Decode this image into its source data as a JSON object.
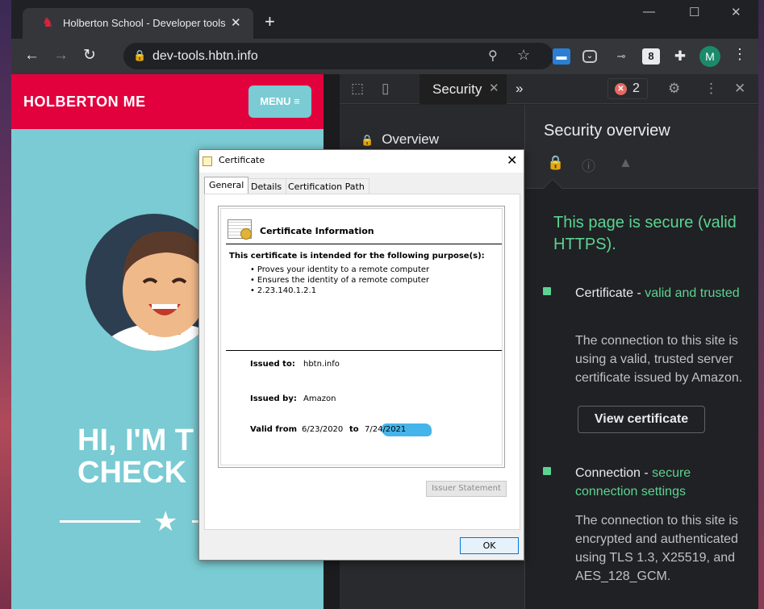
{
  "browser": {
    "tab_title": "Holberton School - Developer tools",
    "tab_close": "✕",
    "new_tab": "+",
    "window_controls": {
      "minimize": "—",
      "maximize": "☐",
      "close": "✕"
    },
    "nav": {
      "back": "←",
      "forward": "→",
      "reload": "↻"
    },
    "url": "dev-tools.hbtn.info",
    "profile_initial": "M",
    "extensions": [
      "snagit-icon",
      "pocket-icon",
      "link-icon",
      "speaker-icon",
      "puzzle-icon"
    ]
  },
  "site": {
    "logo": "HOLBERTON ME",
    "menu_label": "MENU ≡",
    "hero_line1": "HI, I'M T",
    "hero_line2": "CHECK",
    "hero_star": "★",
    "colors": {
      "header": "#e2003d",
      "background": "#7acbd3"
    }
  },
  "devtools": {
    "active_tab": "Security",
    "active_tab_close": "✕",
    "more_tabs": "»",
    "error_count": "2",
    "sidebar": {
      "overview_label": "Overview"
    },
    "security": {
      "heading": "Security overview",
      "secure_message": "This page is secure (valid HTTPS).",
      "certificate": {
        "title": "Certificate",
        "separator": " - ",
        "status": "valid and trusted",
        "description": "The connection to this site is using a valid, trusted server certificate issued by Amazon.",
        "button": "View certificate"
      },
      "connection": {
        "title": "Connection",
        "separator": " - ",
        "status": "secure connection settings",
        "description": "The connection to this site is encrypted and authenticated using TLS 1.3, X25519, and AES_128_GCM."
      }
    },
    "colors": {
      "secure_green": "#5cd392",
      "panel_bg": "#202124"
    }
  },
  "certificate_dialog": {
    "title": "Certificate",
    "close": "✕",
    "tabs": [
      "General",
      "Details",
      "Certification Path"
    ],
    "info_heading": "Certificate Information",
    "purpose_heading": "This certificate is intended for the following purpose(s):",
    "purposes": [
      "Proves your identity to a remote computer",
      "Ensures the identity of a remote computer",
      "2.23.140.1.2.1"
    ],
    "issued_to_label": "Issued to:",
    "issued_to": "hbtn.info",
    "issued_by_label": "Issued by:",
    "issued_by": "Amazon",
    "valid_from_label": "Valid from",
    "valid_from": "6/23/2020",
    "valid_to_label": "to",
    "valid_to": "7/24/2021",
    "issuer_statement_button": "Issuer Statement",
    "ok_button": "OK"
  }
}
